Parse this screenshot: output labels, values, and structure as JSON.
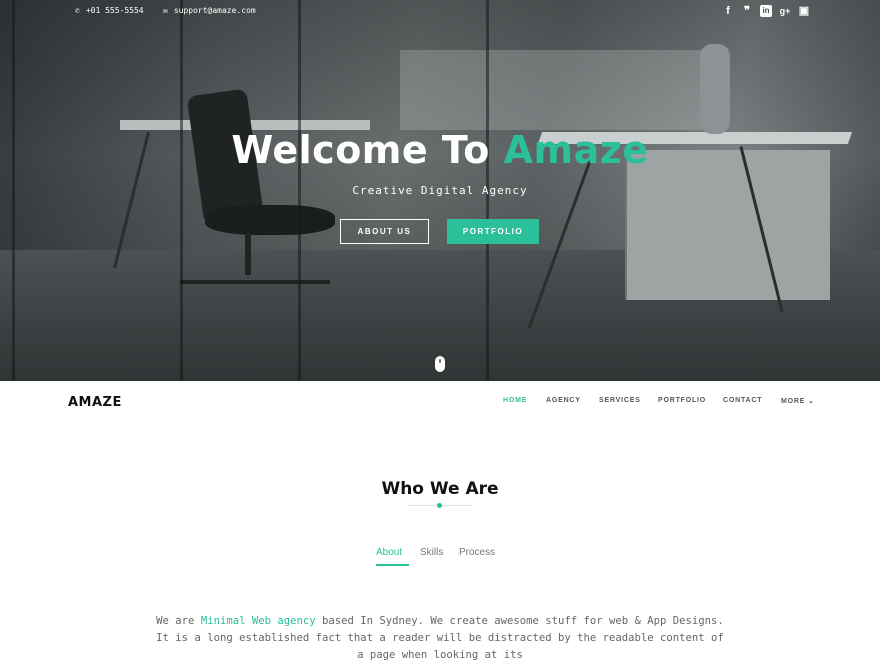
{
  "topbar": {
    "phone": "+01 555-5554",
    "email": "support@amaze.com",
    "social": [
      {
        "icon": "facebook-icon",
        "glyph": "f"
      },
      {
        "icon": "twitter-icon",
        "glyph": "❞"
      },
      {
        "icon": "linkedin-icon",
        "glyph": "in"
      },
      {
        "icon": "google-plus-icon",
        "glyph": "g+"
      },
      {
        "icon": "instagram-icon",
        "glyph": "▣"
      }
    ]
  },
  "hero": {
    "title_prefix": "Welcome To ",
    "title_accent": "Amaze",
    "subtitle": "Creative Digital Agency",
    "btn_about": "ABOUT US",
    "btn_portfolio": "PORTFOLIO"
  },
  "navbar": {
    "brand": "AMAZE",
    "items": [
      "HOME",
      "AGENCY",
      "SERVICES",
      "PORTFOLIO",
      "CONTACT",
      "MORE ⌄"
    ]
  },
  "section": {
    "title": "Who We Are",
    "tabs": [
      "About",
      "Skills",
      "Process"
    ],
    "text_before": "We are ",
    "text_highlight": "Minimal Web agency",
    "text_after": " based In Sydney. We create awesome stuff for web & App Designs. It is a long established fact that a reader will be distracted by the readable content of a page when looking at its"
  },
  "colors": {
    "accent": "#2bbf9a"
  }
}
